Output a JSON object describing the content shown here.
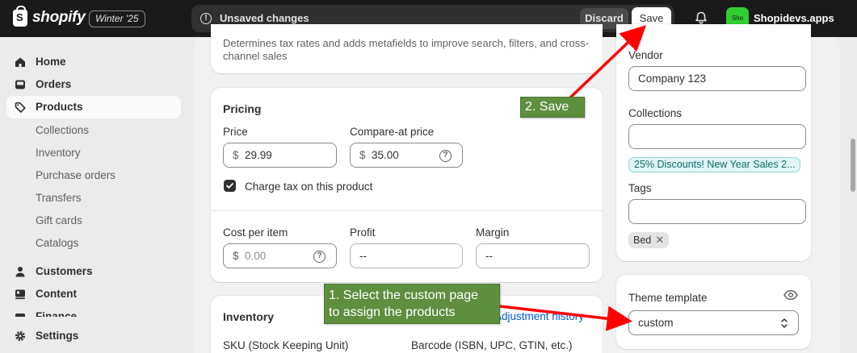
{
  "topbar": {
    "logo_text": "shopify",
    "edition": "Winter '25",
    "unsaved_text": "Unsaved changes",
    "discard_label": "Discard",
    "save_label": "Save",
    "store_avatar_text": "Sho",
    "store_name": "Shopidevs.apps"
  },
  "sidebar": {
    "home": "Home",
    "orders": "Orders",
    "products": "Products",
    "product_sub": [
      "Collections",
      "Inventory",
      "Purchase orders",
      "Transfers",
      "Gift cards",
      "Catalogs"
    ],
    "customers": "Customers",
    "content": "Content",
    "finance": "Finance",
    "settings": "Settings"
  },
  "category_card": {
    "help_text_line1": "Determines tax rates and adds metafields to improve search, filters, and cross-",
    "help_text_line2": "channel sales"
  },
  "pricing": {
    "title": "Pricing",
    "price_label": "Price",
    "price_prefix": "$",
    "price_value": "29.99",
    "compare_label": "Compare-at price",
    "compare_prefix": "$",
    "compare_value": "35.00",
    "charge_tax_label": "Charge tax on this product",
    "charge_tax_checked": true,
    "cost_label": "Cost per item",
    "cost_prefix": "$",
    "cost_placeholder": "0.00",
    "profit_label": "Profit",
    "profit_value": "--",
    "margin_label": "Margin",
    "margin_value": "--"
  },
  "inventory": {
    "title": "Inventory",
    "adjustment_link": "Adjustment history",
    "sku_label": "SKU (Stock Keeping Unit)",
    "barcode_label": "Barcode (ISBN, UPC, GTIN, etc.)"
  },
  "organization": {
    "vendor_label": "Vendor",
    "vendor_value": "Company 123",
    "collections_label": "Collections",
    "collection_badge": "25% Discounts! New Year Sales 2...",
    "tags_label": "Tags",
    "tag_chip": "Bed",
    "tag_remove_glyph": "✕"
  },
  "theme_template": {
    "label": "Theme template",
    "value": "custom"
  },
  "annotations": {
    "callout_save": "2. Save",
    "callout_select_line1": "1. Select the custom page",
    "callout_select_line2": "to assign the products"
  },
  "icons": {
    "unsaved": "!",
    "help": "?"
  },
  "colors": {
    "topbar": "#1a1a1a",
    "callout": "#5e8f3f",
    "arrow": "#ff0000",
    "store_avatar": "#2ecf2e"
  }
}
